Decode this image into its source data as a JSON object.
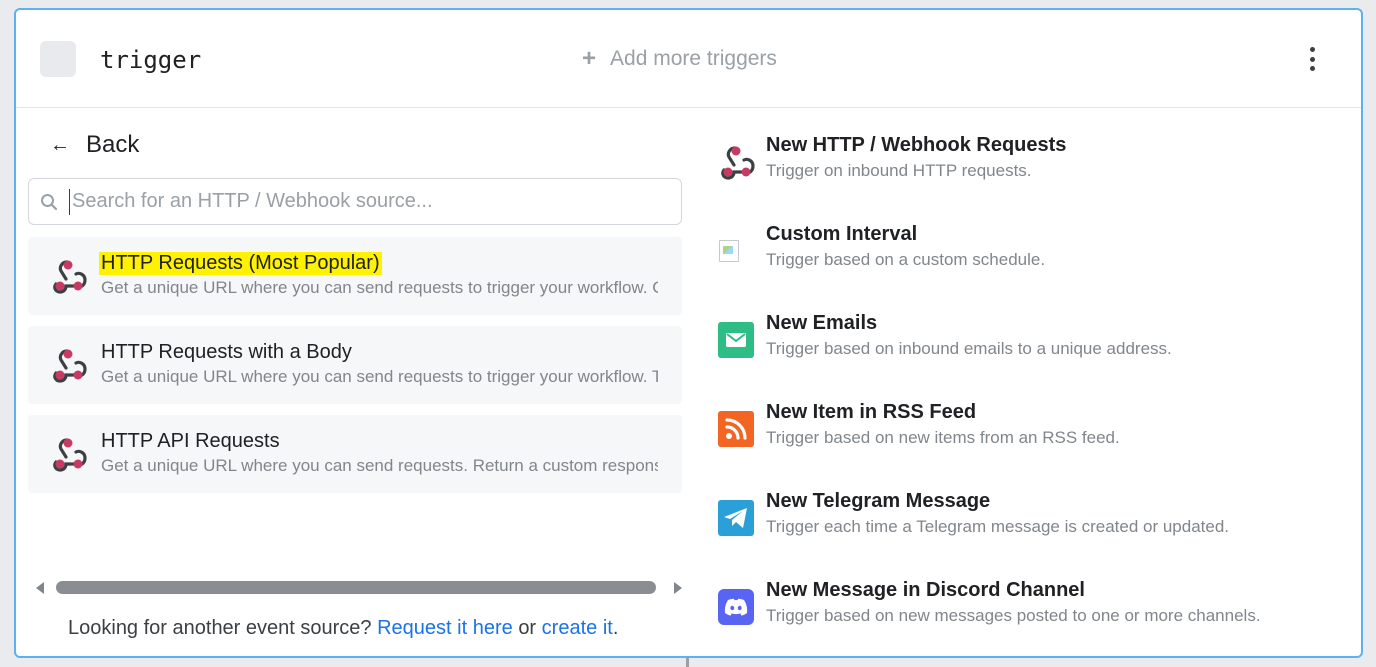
{
  "header": {
    "trigger_name": "trigger",
    "add_more_label": "Add more triggers"
  },
  "left": {
    "back_label": "Back",
    "search_placeholder": "Search for an HTTP / Webhook source...",
    "items": [
      {
        "title": "HTTP Requests (Most Popular)",
        "desc": "Get a unique URL where you can send requests to trigger your workflow. C",
        "highlighted": true
      },
      {
        "title": "HTTP Requests with a Body",
        "desc": "Get a unique URL where you can send requests to trigger your workflow. T",
        "highlighted": false
      },
      {
        "title": "HTTP API Requests",
        "desc": "Get a unique URL where you can send requests. Return a custom response",
        "highlighted": false
      }
    ],
    "footer": {
      "prefix": "Looking for another event source?",
      "link1": "Request it here",
      "middle": "or",
      "link2": "create it",
      "suffix": "."
    }
  },
  "right": {
    "items": [
      {
        "title": "New HTTP / Webhook Requests",
        "desc": "Trigger on inbound HTTP requests.",
        "icon": "webhook-icon"
      },
      {
        "title": "Custom Interval",
        "desc": "Trigger based on a custom schedule.",
        "icon": "broken-image-icon"
      },
      {
        "title": "New Emails",
        "desc": "Trigger based on inbound emails to a unique address.",
        "icon": "email-icon"
      },
      {
        "title": "New Item in RSS Feed",
        "desc": "Trigger based on new items from an RSS feed.",
        "icon": "rss-icon"
      },
      {
        "title": "New Telegram Message",
        "desc": "Trigger each time a Telegram message is created or updated.",
        "icon": "telegram-icon"
      },
      {
        "title": "New Message in Discord Channel",
        "desc": "Trigger based on new messages posted to one or more channels.",
        "icon": "discord-icon"
      }
    ]
  },
  "colors": {
    "accent_border": "#5eb1ef",
    "highlight": "#fff200",
    "link": "#1a73e8",
    "webhook_red": "#c73a63",
    "email_green": "#2ebd85",
    "rss_orange": "#f26522",
    "telegram_blue": "#2a9fd8",
    "discord_purple": "#5865f2"
  }
}
